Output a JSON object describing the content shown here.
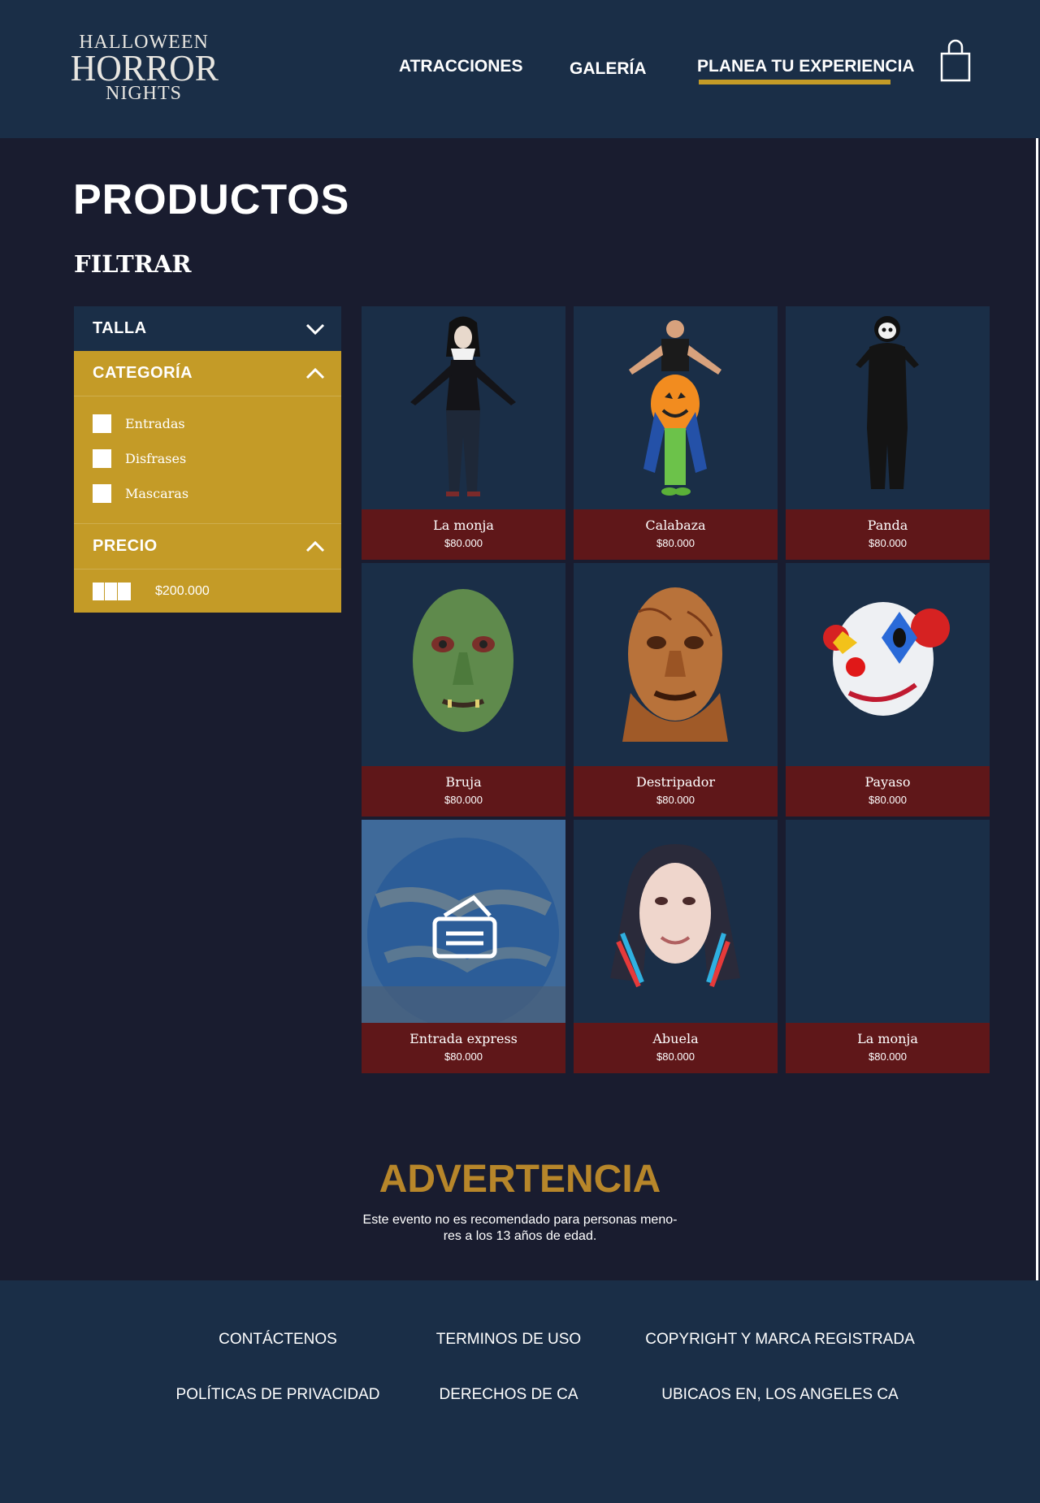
{
  "header": {
    "logo": {
      "line1": "HALLOWEEN",
      "line2": "HORROR",
      "line3": "NIGHTS"
    },
    "nav": [
      {
        "label": "ATRACCIONES"
      },
      {
        "label": "GALERÍA"
      },
      {
        "label": "PLANEA TU EXPERIENCIA",
        "active": true
      }
    ],
    "cart_icon": "shopping-bag-icon",
    "colors": {
      "header_bg": "#1a2e47",
      "accent": "#c49b27"
    }
  },
  "main": {
    "title": "PRODUCTOS",
    "filter_title": "FILTRAR",
    "filters": {
      "size": {
        "label": "TALLA",
        "expanded": false
      },
      "category": {
        "label": "CATEGORÍA",
        "expanded": true,
        "options": [
          {
            "label": "Entradas",
            "checked": false
          },
          {
            "label": "Disfrases",
            "checked": false
          },
          {
            "label": "Mascaras",
            "checked": false
          }
        ]
      },
      "price": {
        "label": "PRECIO",
        "expanded": true,
        "max_value": "$200.000"
      }
    },
    "products": [
      {
        "name": "La monja",
        "price": "$80.000"
      },
      {
        "name": "Calabaza",
        "price": "$80.000"
      },
      {
        "name": "Panda",
        "price": "$80.000"
      },
      {
        "name": "Bruja",
        "price": "$80.000"
      },
      {
        "name": "Destripador",
        "price": "$80.000"
      },
      {
        "name": "Payaso",
        "price": "$80.000"
      },
      {
        "name": "Entrada express",
        "price": "$80.000"
      },
      {
        "name": "Abuela",
        "price": "$80.000"
      },
      {
        "name": "La monja",
        "price": "$80.000"
      }
    ]
  },
  "warning": {
    "title": "ADVERTENCIA",
    "text_line1": "Este evento no es recomendado para personas meno-",
    "text_line2": "res a los 13 años de edad."
  },
  "footer": {
    "links": [
      {
        "label": "CONTÁCTENOS"
      },
      {
        "label": "TERMINOS DE USO"
      },
      {
        "label": "COPYRIGHT Y MARCA REGISTRADA"
      },
      {
        "label": "POLÍTICAS DE PRIVACIDAD"
      },
      {
        "label": "DERECHOS DE CA"
      },
      {
        "label": "UBICAOS EN, LOS ANGELES CA"
      }
    ]
  }
}
